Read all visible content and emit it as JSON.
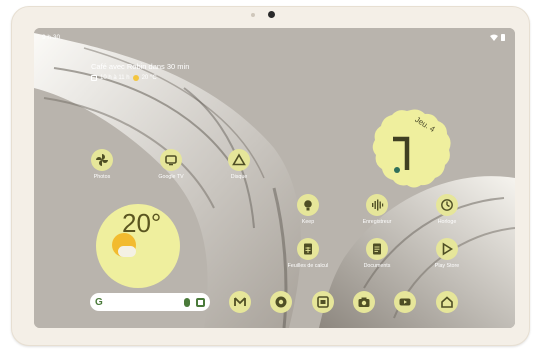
{
  "status_bar": {
    "time": "9 h 30"
  },
  "glance": {
    "event": "Café avec Robin dans 30 min",
    "detail_time": "10 h à 11 h",
    "detail_temp": "20 °C"
  },
  "weather": {
    "temperature": "20°"
  },
  "clock": {
    "date": "Jeu. 4",
    "hour_display": "7"
  },
  "apps": [
    {
      "label": "Photos",
      "icon": "pinwheel-icon"
    },
    {
      "label": "Google TV",
      "icon": "tv-icon"
    },
    {
      "label": "Disque",
      "icon": "drive-icon"
    },
    {
      "label": "Keep",
      "icon": "bulb-icon"
    },
    {
      "label": "Enregistreur",
      "icon": "waveform-icon"
    },
    {
      "label": "Horloge",
      "icon": "clock-icon"
    },
    {
      "label": "Feuilles de calcul",
      "icon": "sheets-icon"
    },
    {
      "label": "Documents",
      "icon": "docs-icon"
    },
    {
      "label": "Play Store",
      "icon": "play-icon"
    }
  ],
  "dock": [
    "gmail-icon",
    "chrome-icon",
    "calendar-icon",
    "camera-icon",
    "youtube-icon",
    "home-icon"
  ],
  "search": {
    "logo": "G"
  },
  "colors": {
    "icon_bg": "#e6e69a",
    "weather_bg": "#efef9e",
    "icon_fg": "#4f4f25"
  }
}
